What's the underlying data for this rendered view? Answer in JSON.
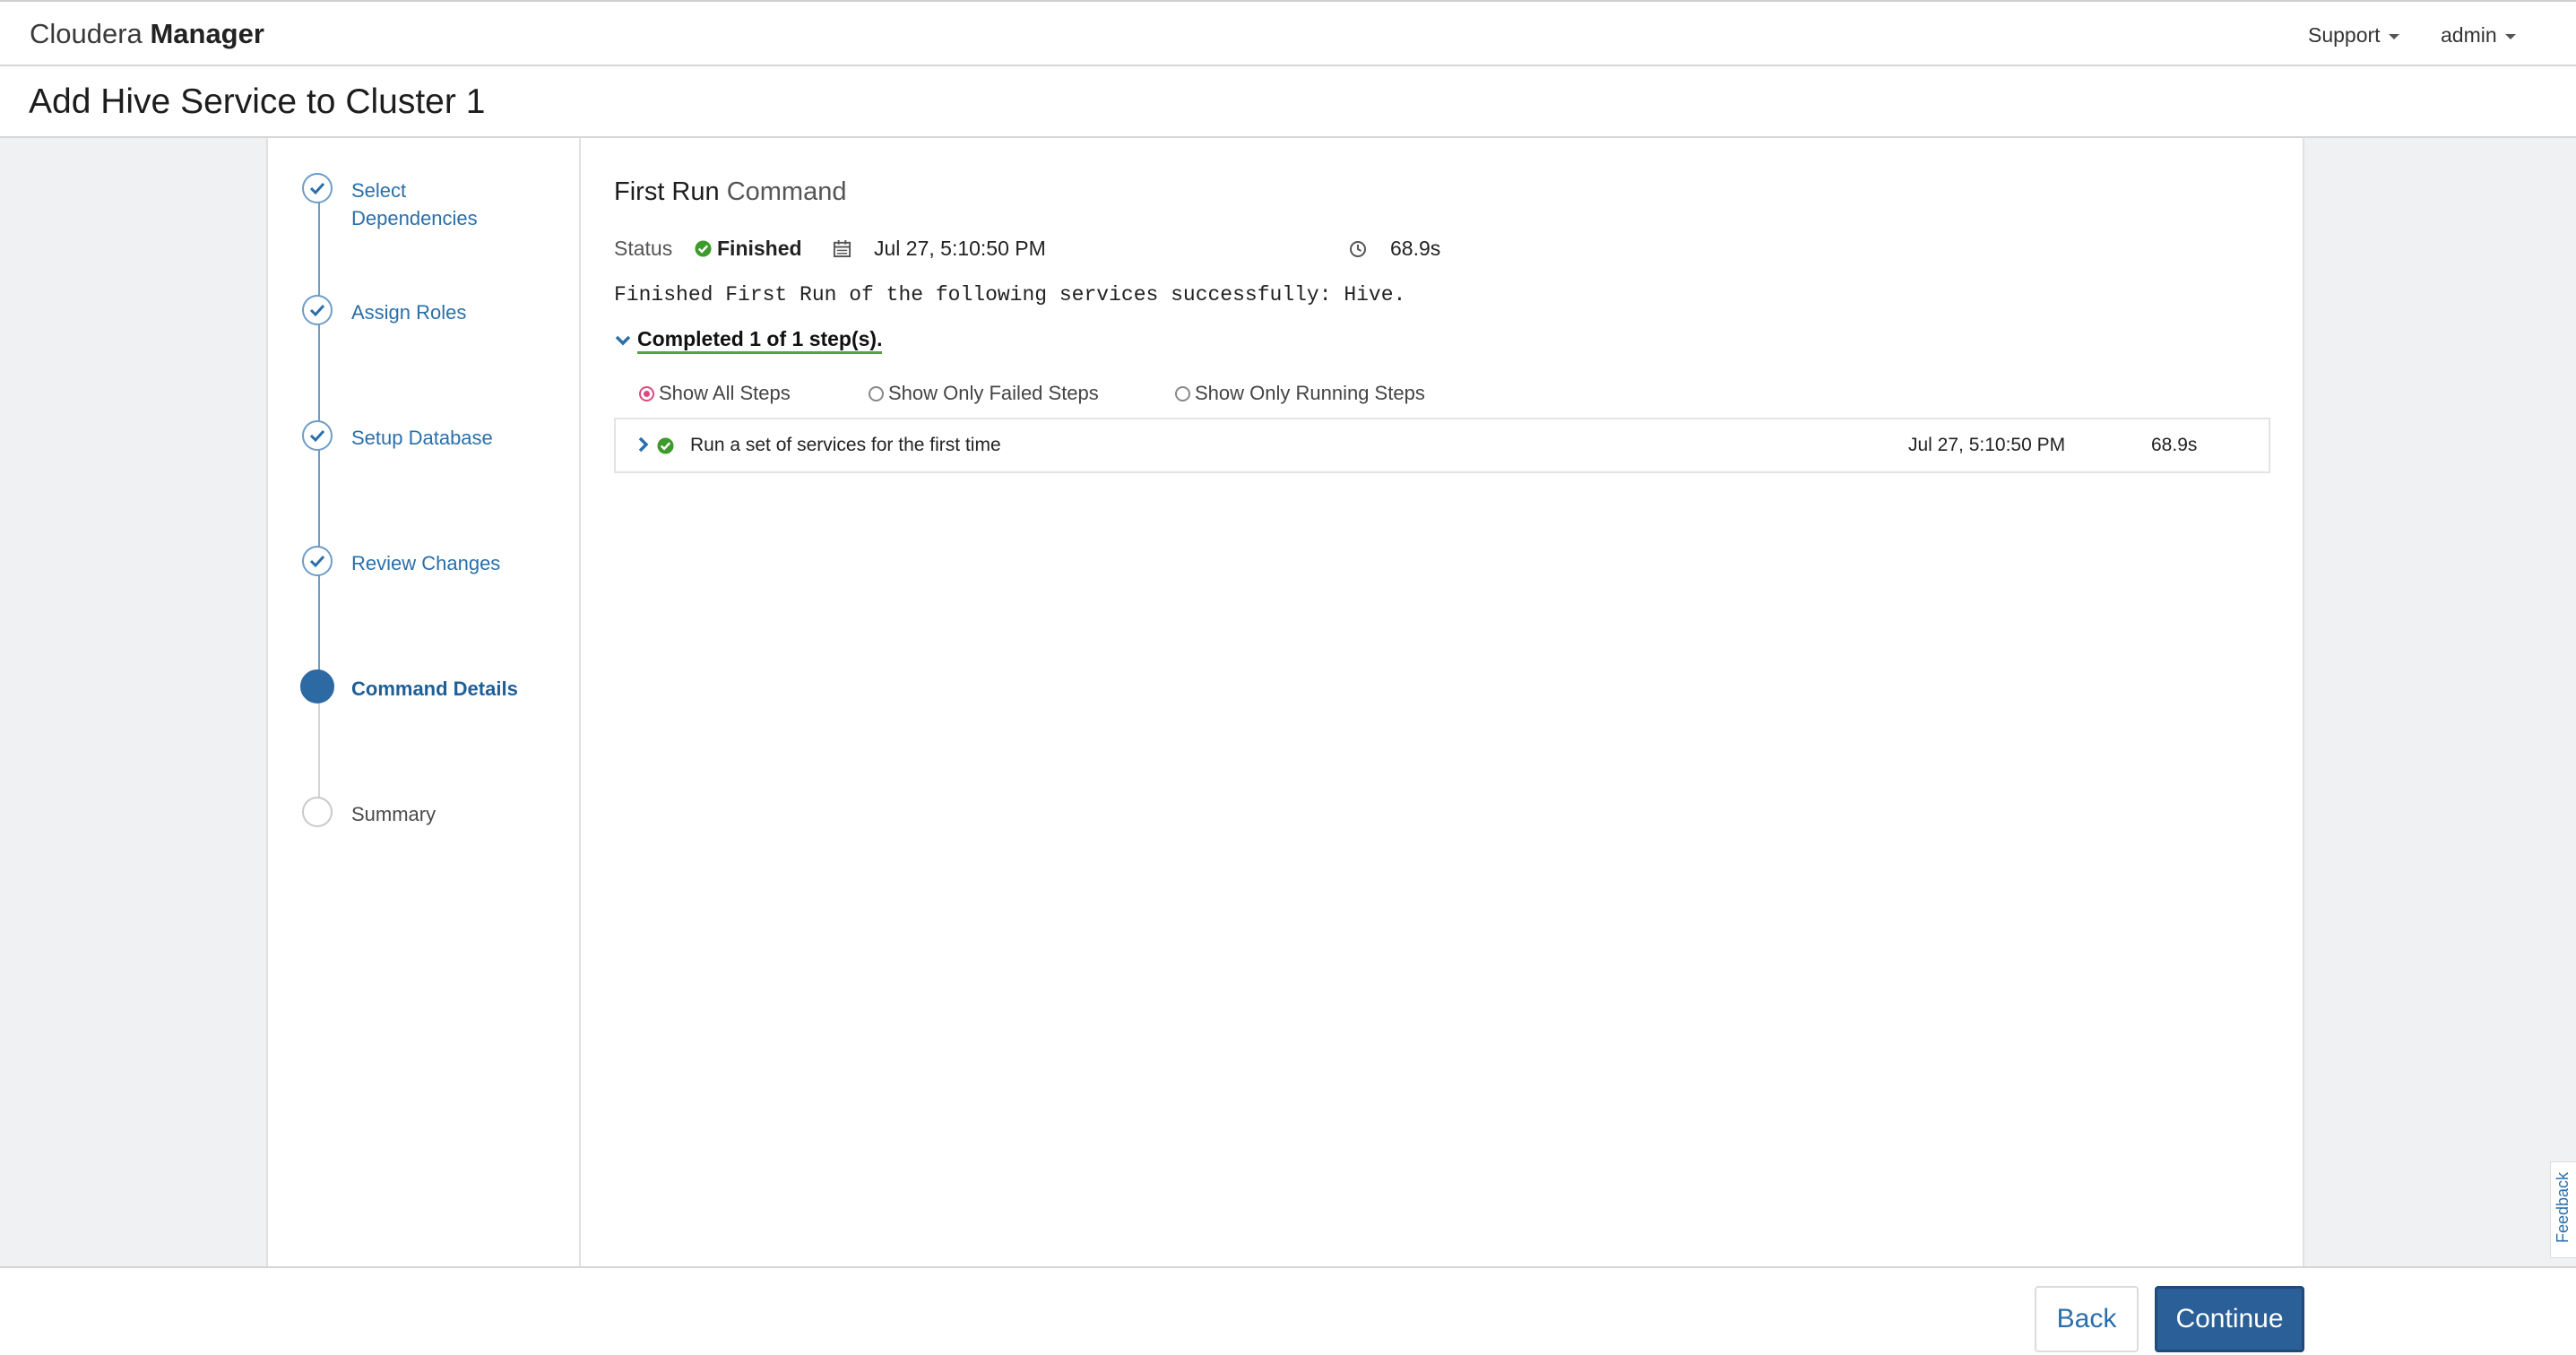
{
  "header": {
    "brand_light": "Cloudera",
    "brand_bold": "Manager",
    "support_label": "Support",
    "user_label": "admin"
  },
  "page": {
    "title": "Add Hive Service to Cluster 1"
  },
  "wizard_steps": [
    {
      "label": "Select Dependencies",
      "state": "done"
    },
    {
      "label": "Assign Roles",
      "state": "done"
    },
    {
      "label": "Setup Database",
      "state": "done"
    },
    {
      "label": "Review Changes",
      "state": "done"
    },
    {
      "label": "Command Details",
      "state": "active"
    },
    {
      "label": "Summary",
      "state": "pending"
    }
  ],
  "command": {
    "title_main": "First Run",
    "title_light": "Command",
    "status_label": "Status",
    "status_value": "Finished",
    "date": "Jul 27, 5:10:50 PM",
    "duration": "68.9s",
    "message": "Finished First Run of the following services successfully: Hive.",
    "completed_text": "Completed 1 of 1 step(s)."
  },
  "filters": {
    "all": "Show All Steps",
    "failed": "Show Only Failed Steps",
    "running": "Show Only Running Steps",
    "selected": "all"
  },
  "steps": [
    {
      "name": "Run a set of services for the first time",
      "date": "Jul 27, 5:10:50 PM",
      "duration": "68.9s",
      "status": "success"
    }
  ],
  "footer": {
    "back_label": "Back",
    "continue_label": "Continue"
  },
  "feedback_label": "Feedback",
  "colors": {
    "accent": "#2a6fab",
    "success": "#3f9a2c",
    "radio_selected": "#d94a84",
    "primary_button": "#2a5f97"
  }
}
